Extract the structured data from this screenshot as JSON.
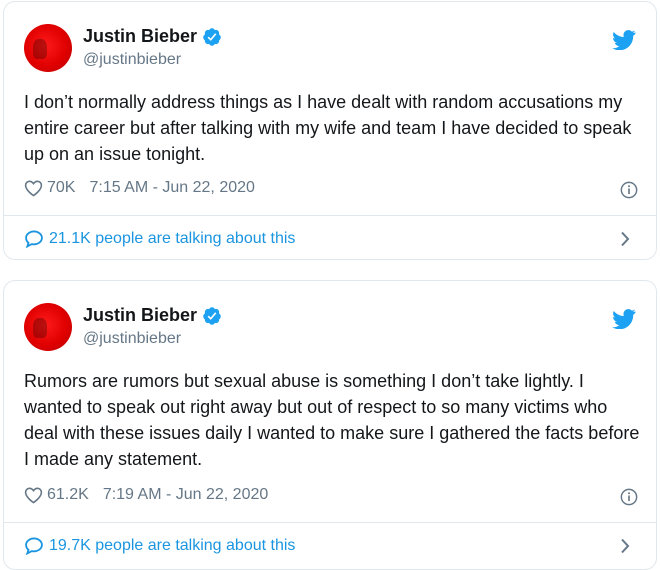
{
  "colors": {
    "twitter_blue": "#1da1f2",
    "link_blue": "#1b95e0",
    "secondary_text": "#657786",
    "avatar_red": "#e00000"
  },
  "tweets": [
    {
      "name": "Justin Bieber",
      "handle": "@justinbieber",
      "text": "I don’t normally address things as I have dealt with random accusations my entire career but after talking with my wife and team I have decided to speak up on an issue tonight.",
      "likes": "70K",
      "timestamp": "7:15 AM - Jun 22, 2020",
      "talking": "21.1K people are talking about this",
      "icons": [
        "verified-icon",
        "twitter-bird-icon",
        "heart-icon",
        "info-icon",
        "speech-bubble-icon",
        "chevron-right-icon"
      ]
    },
    {
      "name": "Justin Bieber",
      "handle": "@justinbieber",
      "text": "Rumors are rumors but sexual abuse is something I don’t take lightly. I wanted to speak out right away but out of respect to so many victims who deal with these issues daily I wanted to make sure I gathered the facts before I made any statement.",
      "likes": "61.2K",
      "timestamp": "7:19 AM - Jun 22, 2020",
      "talking": "19.7K people are talking about this",
      "icons": [
        "verified-icon",
        "twitter-bird-icon",
        "heart-icon",
        "info-icon",
        "speech-bubble-icon",
        "chevron-right-icon"
      ]
    }
  ]
}
